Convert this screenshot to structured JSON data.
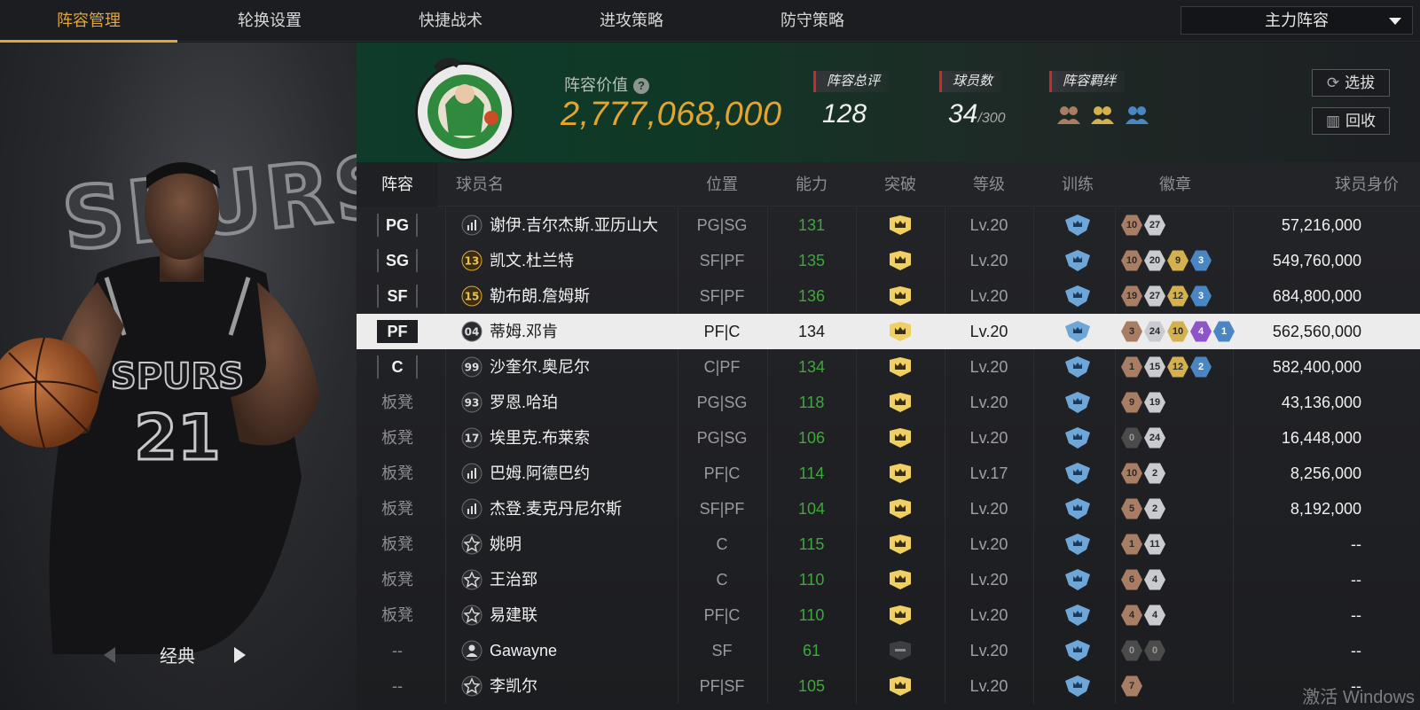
{
  "nav": {
    "tabs": [
      "阵容管理",
      "轮换设置",
      "快捷战术",
      "进攻策略",
      "防守策略"
    ],
    "active_tab": 0,
    "lineup_select": "主力阵容"
  },
  "hero": {
    "watermark_text": "SPURS",
    "label": "经典"
  },
  "summary": {
    "value_label": "阵容价值",
    "value": "2,777,068,000",
    "rating_label": "阵容总评",
    "rating": "128",
    "players_label": "球员数",
    "players_count": "34",
    "players_max": "/300",
    "bond_label": "阵容羁绊",
    "select_btn": "选拔",
    "recycle_btn": "回收"
  },
  "table": {
    "headers": [
      "阵容",
      "球员名",
      "位置",
      "能力",
      "突破",
      "等级",
      "训练",
      "徽章",
      "球员身价"
    ],
    "rows": [
      {
        "slot": "PG",
        "starter": true,
        "jersey": "bars",
        "name": "谢伊.吉尔杰斯.亚历山大",
        "pos": "PG|SG",
        "ability": "131",
        "breakthrough": "crown",
        "level": "Lv.20",
        "badges": [
          [
            "b-bronze",
            "10"
          ],
          [
            "b-silver",
            "27"
          ]
        ],
        "price": "57,216,000"
      },
      {
        "slot": "SG",
        "starter": true,
        "jersey": "13",
        "name": "凯文.杜兰特",
        "pos": "SF|PF",
        "ability": "135",
        "breakthrough": "crown",
        "level": "Lv.20",
        "badges": [
          [
            "b-bronze",
            "10"
          ],
          [
            "b-silver",
            "20"
          ],
          [
            "b-gold",
            "9"
          ],
          [
            "b-blue",
            "3"
          ]
        ],
        "price": "549,760,000"
      },
      {
        "slot": "SF",
        "starter": true,
        "jersey": "15",
        "name": "勒布朗.詹姆斯",
        "pos": "SF|PF",
        "ability": "136",
        "breakthrough": "crown",
        "level": "Lv.20",
        "badges": [
          [
            "b-bronze",
            "19"
          ],
          [
            "b-silver",
            "27"
          ],
          [
            "b-gold",
            "12"
          ],
          [
            "b-blue",
            "3"
          ]
        ],
        "price": "684,800,000"
      },
      {
        "slot": "PF",
        "starter": true,
        "selected": true,
        "jersey": "04",
        "name": "蒂姆.邓肯",
        "pos": "PF|C",
        "ability": "134",
        "breakthrough": "crown",
        "level": "Lv.20",
        "badges": [
          [
            "b-bronze",
            "3"
          ],
          [
            "b-silver",
            "24"
          ],
          [
            "b-gold",
            "10"
          ],
          [
            "b-purple",
            "4"
          ],
          [
            "b-blue",
            "1"
          ]
        ],
        "price": "562,560,000"
      },
      {
        "slot": "C",
        "starter": true,
        "jersey": "99",
        "name": "沙奎尔.奥尼尔",
        "pos": "C|PF",
        "ability": "134",
        "breakthrough": "crown",
        "level": "Lv.20",
        "badges": [
          [
            "b-bronze",
            "1"
          ],
          [
            "b-silver",
            "15"
          ],
          [
            "b-gold",
            "12"
          ],
          [
            "b-blue",
            "2"
          ]
        ],
        "price": "582,400,000"
      },
      {
        "slot": "板凳",
        "starter": false,
        "jersey": "93",
        "name": "罗恩.哈珀",
        "pos": "PG|SG",
        "ability": "118",
        "breakthrough": "crown",
        "level": "Lv.20",
        "badges": [
          [
            "b-bronze",
            "9"
          ],
          [
            "b-silver",
            "19"
          ]
        ],
        "price": "43,136,000"
      },
      {
        "slot": "板凳",
        "starter": false,
        "jersey": "17",
        "name": "埃里克.布莱索",
        "pos": "PG|SG",
        "ability": "106",
        "breakthrough": "crown",
        "level": "Lv.20",
        "badges": [
          [
            "b-dark",
            "0"
          ],
          [
            "b-silver",
            "24"
          ]
        ],
        "price": "16,448,000"
      },
      {
        "slot": "板凳",
        "starter": false,
        "jersey": "bars",
        "name": "巴姆.阿德巴约",
        "pos": "PF|C",
        "ability": "114",
        "breakthrough": "crown",
        "level": "Lv.17",
        "badges": [
          [
            "b-bronze",
            "10"
          ],
          [
            "b-silver",
            "2"
          ]
        ],
        "price": "8,256,000"
      },
      {
        "slot": "板凳",
        "starter": false,
        "jersey": "bars",
        "name": "杰登.麦克丹尼尔斯",
        "pos": "SF|PF",
        "ability": "104",
        "breakthrough": "crown",
        "level": "Lv.20",
        "badges": [
          [
            "b-bronze",
            "5"
          ],
          [
            "b-silver",
            "2"
          ]
        ],
        "price": "8,192,000"
      },
      {
        "slot": "板凳",
        "starter": false,
        "jersey": "star",
        "name": "姚明",
        "pos": "C",
        "ability": "115",
        "breakthrough": "crown",
        "level": "Lv.20",
        "badges": [
          [
            "b-bronze",
            "1"
          ],
          [
            "b-silver",
            "11"
          ]
        ],
        "price": "--"
      },
      {
        "slot": "板凳",
        "starter": false,
        "jersey": "star",
        "name": "王治郅",
        "pos": "C",
        "ability": "110",
        "breakthrough": "crown",
        "level": "Lv.20",
        "badges": [
          [
            "b-bronze",
            "6"
          ],
          [
            "b-silver",
            "4"
          ]
        ],
        "price": "--"
      },
      {
        "slot": "板凳",
        "starter": false,
        "jersey": "star",
        "name": "易建联",
        "pos": "PF|C",
        "ability": "110",
        "breakthrough": "crown",
        "level": "Lv.20",
        "badges": [
          [
            "b-bronze",
            "4"
          ],
          [
            "b-silver",
            "4"
          ]
        ],
        "price": "--"
      },
      {
        "slot": "--",
        "starter": false,
        "jersey": "person",
        "name": "Gawayne",
        "pos": "SF",
        "ability": "61",
        "breakthrough": "locked",
        "level": "Lv.20",
        "badges": [
          [
            "b-dark",
            "0"
          ],
          [
            "b-dark",
            "0"
          ]
        ],
        "price": "--"
      },
      {
        "slot": "--",
        "starter": false,
        "jersey": "star",
        "name": "李凯尔",
        "pos": "PF|SF",
        "ability": "105",
        "breakthrough": "crown",
        "level": "Lv.20",
        "badges": [
          [
            "b-bronze",
            "7"
          ]
        ],
        "price": "--"
      }
    ]
  },
  "watermark": "激活 Windows",
  "colors": {
    "accent": "#e0a63a",
    "green_value": "#3ea83a",
    "value_gold": "#e2a531",
    "tag_red": "#c72c2c"
  }
}
